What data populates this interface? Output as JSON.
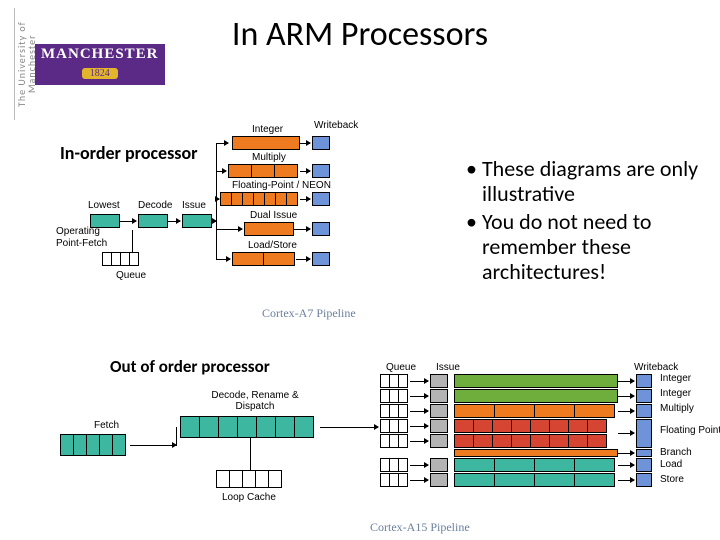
{
  "logo": {
    "side_text": "The University of Manchester",
    "main": "MANCHESTER",
    "year": "1824"
  },
  "title": "In ARM Processors",
  "labels": {
    "in_order": "In-order  processor",
    "out_of_order": "Out of order processor"
  },
  "bullets": {
    "b1": "These diagrams are only illustrative",
    "b2": "You do not need to remember these architectures!"
  },
  "captions": {
    "a7": "Cortex-A7 Pipeline",
    "a15": "Cortex-A15 Pipeline"
  },
  "a7": {
    "stages": {
      "writeback": "Writeback",
      "decode": "Decode",
      "issue": "Issue",
      "lowest": "Lowest"
    },
    "front": {
      "operating": "Operating",
      "point_fetch": "Point-Fetch",
      "queue": "Queue"
    },
    "units": {
      "integer": "Integer",
      "multiply": "Multiply",
      "fp": "Floating-Point / NEON",
      "dual": "Dual Issue",
      "ls": "Load/Store"
    }
  },
  "a15": {
    "front": {
      "fetch": "Fetch",
      "drd": "Decode, Rename & Dispatch",
      "loop": "Loop Cache"
    },
    "stages": {
      "queue": "Queue",
      "issue": "Issue",
      "writeback": "Writeback"
    },
    "units": {
      "integer": "Integer",
      "multiply": "Multiply",
      "fp": "Floating Point / NEON",
      "branch": "Branch",
      "load": "Load",
      "store": "Store"
    }
  }
}
